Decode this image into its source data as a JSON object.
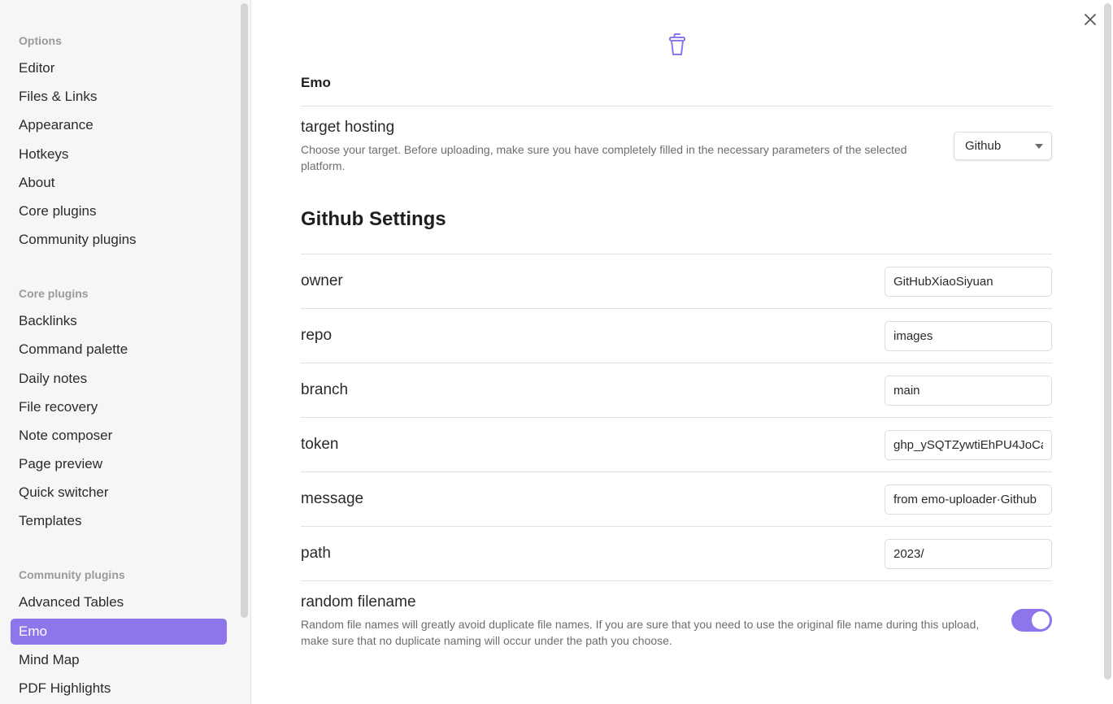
{
  "sidebar": {
    "options_heading": "Options",
    "options": [
      "Editor",
      "Files & Links",
      "Appearance",
      "Hotkeys",
      "About",
      "Core plugins",
      "Community plugins"
    ],
    "core_heading": "Core plugins",
    "core_plugins": [
      "Backlinks",
      "Command palette",
      "Daily notes",
      "File recovery",
      "Note composer",
      "Page preview",
      "Quick switcher",
      "Templates"
    ],
    "community_heading": "Community plugins",
    "community_plugins": [
      "Advanced Tables",
      "Emo",
      "Mind Map",
      "PDF Highlights"
    ],
    "active_item": "Emo"
  },
  "content": {
    "plugin_icon": "cup-icon",
    "plugin_title": "Emo",
    "target_hosting": {
      "name": "target hosting",
      "description": "Choose your target. Before uploading, make sure you have completely filled in the necessary parameters of the selected platform.",
      "selected": "Github"
    },
    "section_title": "Github Settings",
    "fields": {
      "owner": {
        "label": "owner",
        "value": "GitHubXiaoSiyuan"
      },
      "repo": {
        "label": "repo",
        "value": "images"
      },
      "branch": {
        "label": "branch",
        "value": "main"
      },
      "token": {
        "label": "token",
        "value": "ghp_ySQTZywtiEhPU4JoCa"
      },
      "message": {
        "label": "message",
        "value": "from emo-uploader·Github"
      },
      "path": {
        "label": "path",
        "value": "2023/"
      }
    },
    "random_filename": {
      "name": "random filename",
      "description": "Random file names will greatly avoid duplicate file names. If you are sure that you need to use the original file name during this upload, make sure that no duplicate naming will occur under the path you choose.",
      "enabled": true
    }
  },
  "colors": {
    "accent": "#8f75ec",
    "sidebar_bg": "#f6f6f6"
  }
}
